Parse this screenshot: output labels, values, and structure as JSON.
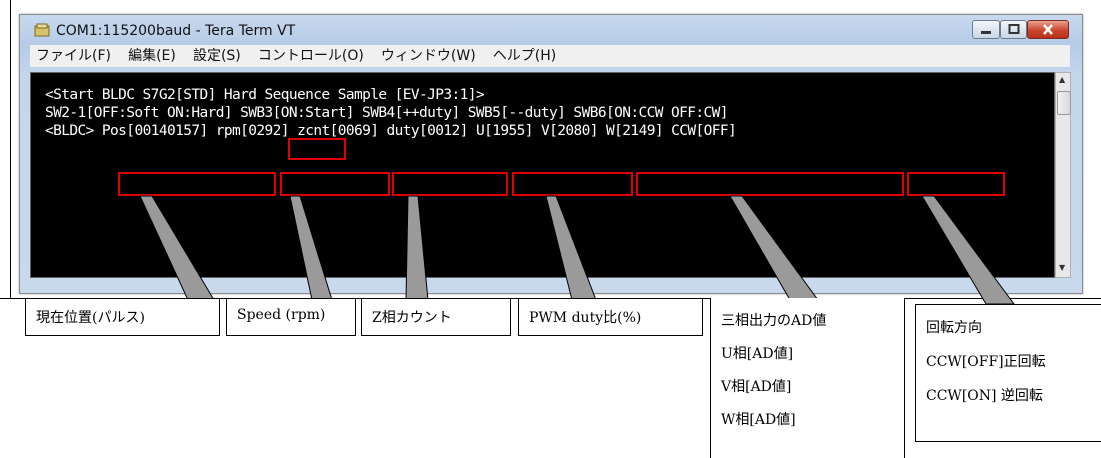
{
  "window": {
    "title": "COM1:115200baud - Tera Term VT"
  },
  "menu": [
    "ファイル(F)",
    "編集(E)",
    "設定(S)",
    "コントロール(O)",
    "ウィンドウ(W)",
    "ヘルプ(H)"
  ],
  "terminal": {
    "line1": {
      "a": "<Start BLDC S7G2[STD] ",
      "hard": "Hard",
      "b": " Sequence Sample [EV-JP3:1]>"
    },
    "line2": "SW2-1[OFF:Soft ON:Hard] SWB3[ON:Start] SWB4[++duty] SWB5[--duty] SWB6[ON:CCW OFF:CW]",
    "line3": {
      "prompt": "<BLDC> ",
      "pos": "Pos[00140157]",
      "rpm": "rpm[0292]",
      "zcnt": "zcnt[0069]",
      "duty": "duty[0012]",
      "uvw": "U[1955] V[2080] W[2149]",
      "ccw": "CCW[OFF]"
    }
  },
  "callouts": {
    "pos": "現在位置(パルス)",
    "speed": "Speed (rpm)",
    "zphase": "Z相カウント",
    "pwm": "PWM duty比(%)",
    "ad": [
      "三相出力のAD値",
      "U相[AD値]",
      "V相[AD値]",
      "W相[AD値]"
    ],
    "dir": [
      "回転方向",
      "CCW[OFF]正回転",
      "CCW[ON]  逆回転"
    ]
  },
  "colors": {
    "highlight": "#e00000",
    "terminal_bg": "#000000",
    "terminal_fg": "#ffffff"
  }
}
